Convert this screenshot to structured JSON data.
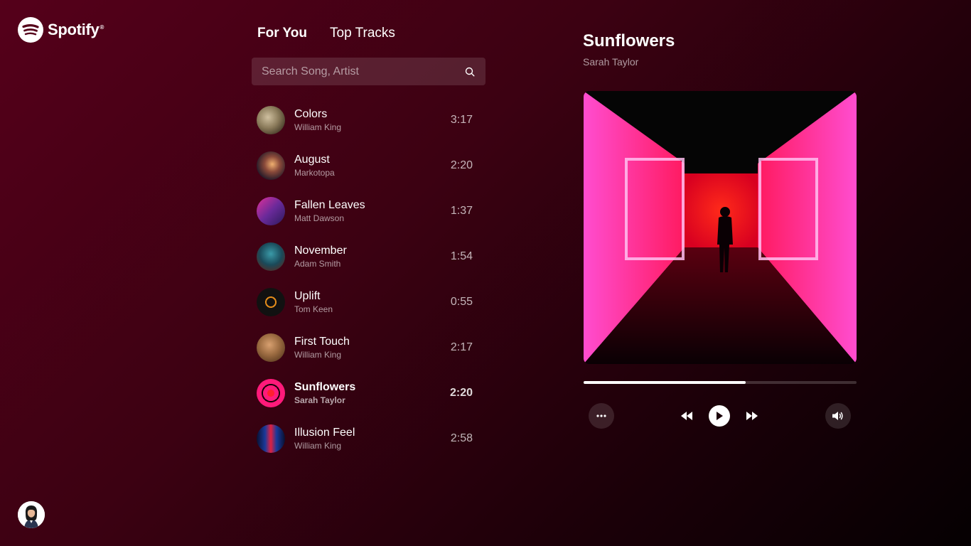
{
  "brand": {
    "name": "Spotify",
    "reg_mark": "®",
    "icon": "spotify-logo-icon"
  },
  "tabs": [
    {
      "label": "For You",
      "active": true
    },
    {
      "label": "Top Tracks",
      "active": false
    }
  ],
  "search": {
    "placeholder": "Search Song, Artist",
    "value": "",
    "icon": "search-icon"
  },
  "tracks": [
    {
      "title": "Colors",
      "artist": "William King",
      "duration": "3:17",
      "active": false
    },
    {
      "title": "August",
      "artist": "Markotopa",
      "duration": "2:20",
      "active": false
    },
    {
      "title": "Fallen Leaves",
      "artist": "Matt Dawson",
      "duration": "1:37",
      "active": false
    },
    {
      "title": "November",
      "artist": "Adam Smith",
      "duration": "1:54",
      "active": false
    },
    {
      "title": "Uplift",
      "artist": "Tom Keen",
      "duration": "0:55",
      "active": false
    },
    {
      "title": "First Touch",
      "artist": "William King",
      "duration": "2:17",
      "active": false
    },
    {
      "title": "Sunflowers",
      "artist": "Sarah Taylor",
      "duration": "2:20",
      "active": true
    },
    {
      "title": "Illusion Feel",
      "artist": "William King",
      "duration": "2:58",
      "active": false
    }
  ],
  "now_playing": {
    "title": "Sunflowers",
    "artist": "Sarah Taylor",
    "progress_fraction": 0.595
  },
  "controls": {
    "more": "more-horizontal-icon",
    "previous": "rewind-icon",
    "play": "play-icon",
    "next": "fast-forward-icon",
    "volume": "volume-icon"
  },
  "colors": {
    "background_start": "#55001a",
    "background_end": "#050002",
    "accent_pink": "#ff1a7a"
  }
}
